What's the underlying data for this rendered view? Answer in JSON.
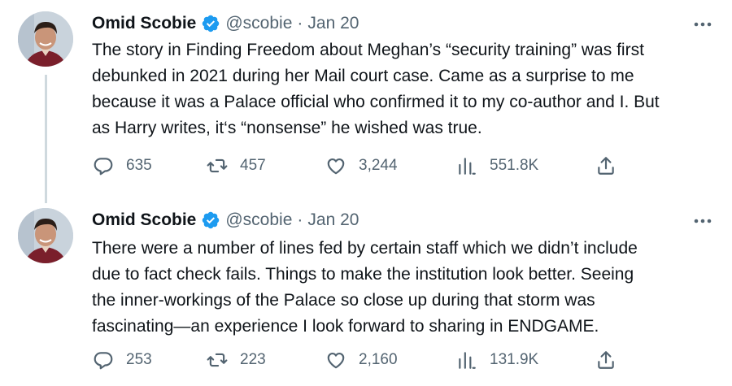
{
  "tweets": [
    {
      "author": {
        "name": "Omid Scobie",
        "handle": "@scobie"
      },
      "separator": "·",
      "date": "Jan 20",
      "text": "The story in Finding Freedom about Meghan’s “security training” was first\ndebunked in 2021 during her Mail court case. Came as a surprise to me\nbecause it was a Palace official who confirmed it to my co-author and I. But\nas Harry writes, it‘s  “nonsense” he wished was true.",
      "stats": {
        "replies": "635",
        "retweets": "457",
        "likes": "3,244",
        "views": "551.8K"
      }
    },
    {
      "author": {
        "name": "Omid Scobie",
        "handle": "@scobie"
      },
      "separator": "·",
      "date": "Jan 20",
      "text": "There were a number of lines fed by certain staff which we didn’t include\ndue to fact check fails. Things to make the institution look better. Seeing\nthe inner-workings of the Palace so close up during that storm was\nfascinating—an experience I look forward to sharing in ENDGAME.",
      "stats": {
        "replies": "253",
        "retweets": "223",
        "likes": "2,160",
        "views": "131.9K"
      }
    }
  ],
  "icons": {
    "verified": "verified-badge-icon",
    "more": "more-icon",
    "reply": "reply-icon",
    "retweet": "retweet-icon",
    "like": "heart-icon",
    "views": "views-icon",
    "share": "share-icon"
  },
  "colors": {
    "verified_blue": "#1d9bf0",
    "secondary_text": "#536471",
    "primary_text": "#0f1419",
    "thread_line": "#cfd9de"
  }
}
